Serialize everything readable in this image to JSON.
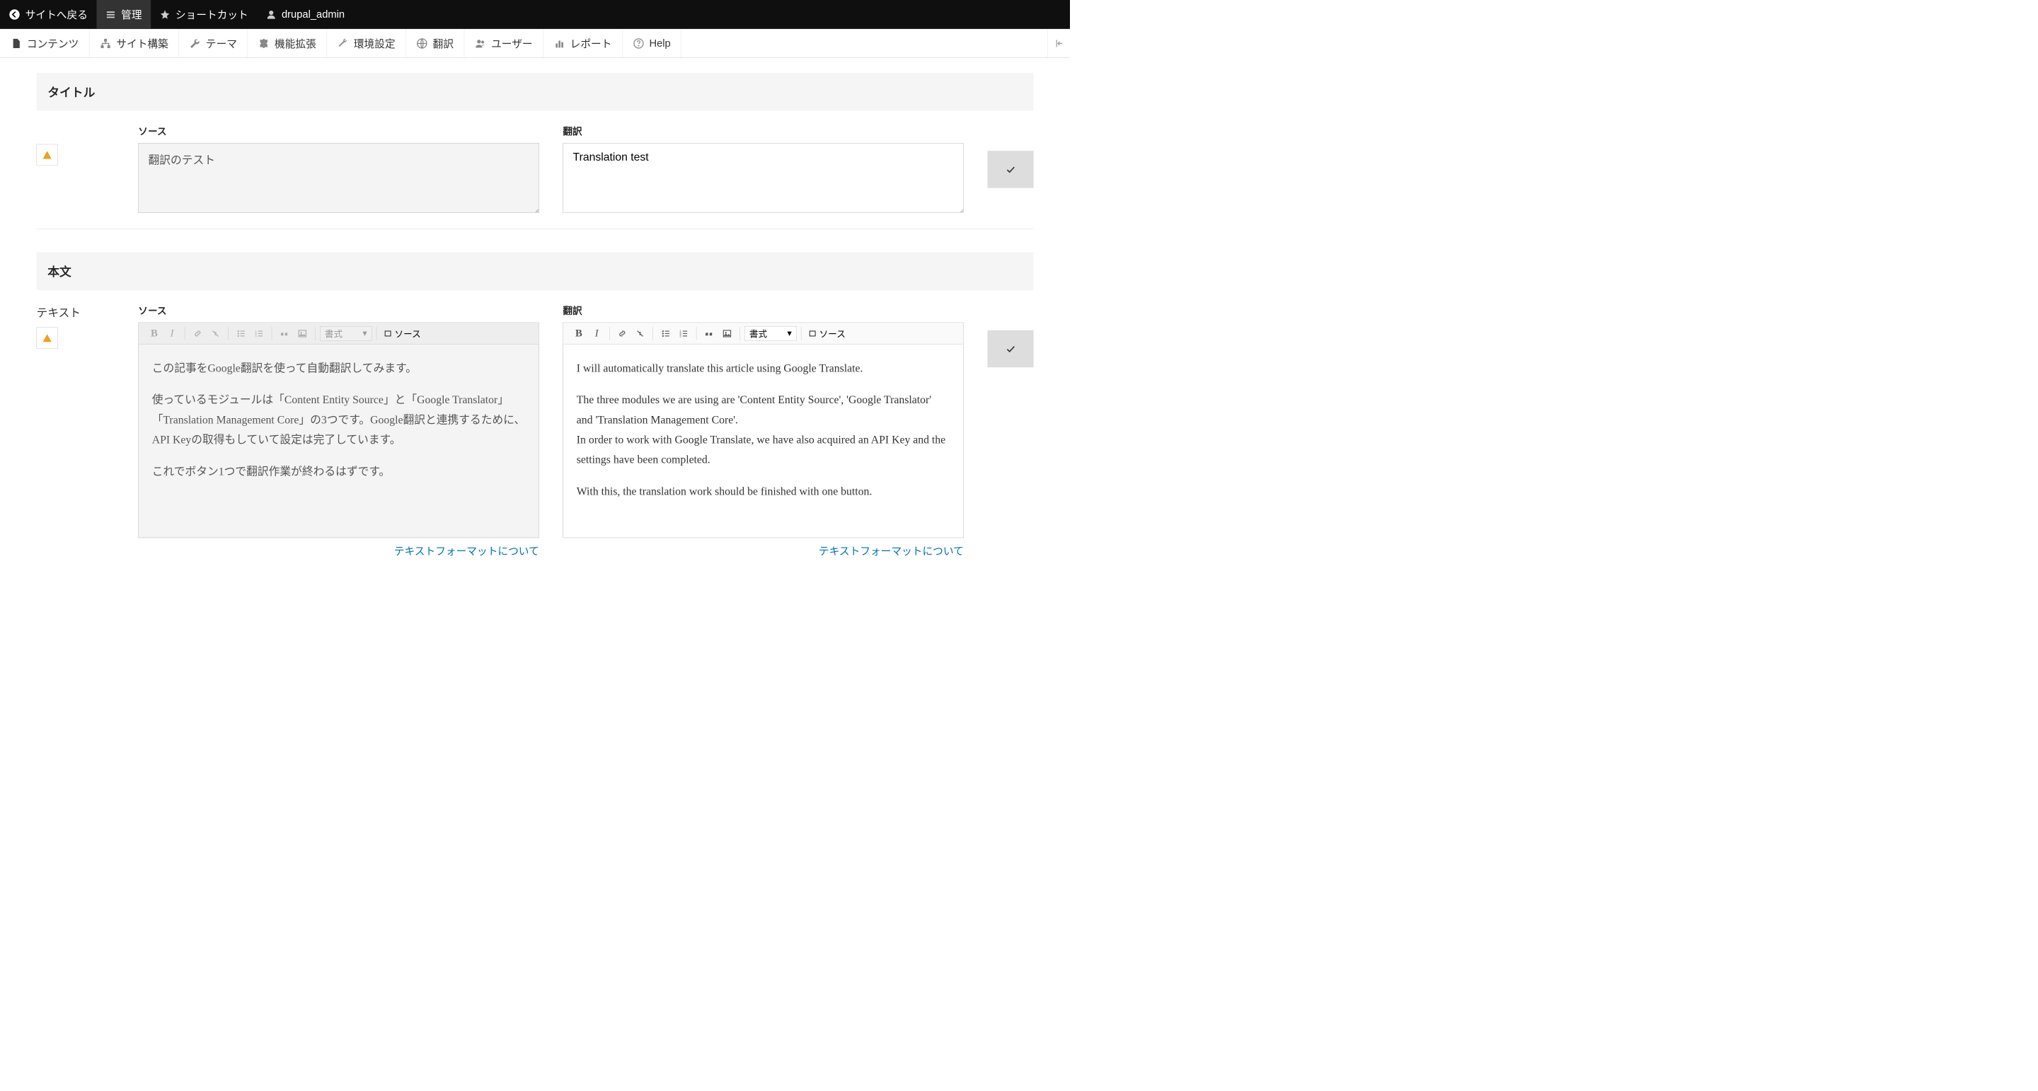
{
  "topbar": {
    "back": "サイトへ戻る",
    "admin": "管理",
    "shortcuts": "ショートカット",
    "user": "drupal_admin"
  },
  "menubar": {
    "content": "コンテンツ",
    "structure": "サイト構築",
    "themes": "テーマ",
    "extensions": "機能拡張",
    "config": "環境設定",
    "translate": "翻訳",
    "users": "ユーザー",
    "reports": "レポート",
    "help": "Help"
  },
  "sections": {
    "title": {
      "header": "タイトル",
      "source_label": "ソース",
      "target_label": "翻訳",
      "source_value": "翻訳のテスト",
      "target_value": "Translation test"
    },
    "body": {
      "header": "本文",
      "side_label": "テキスト",
      "source_label": "ソース",
      "target_label": "翻訳",
      "format_label": "書式",
      "source_btn": "ソース",
      "source_paras": [
        "この記事をGoogle翻訳を使って自動翻訳してみます。",
        "使っているモジュールは「Content Entity Source」と「Google Translator」「Translation Management Core」の3つです。Google翻訳と連携するために、API Keyの取得もしていて設定は完了しています。",
        "これでボタン1つで翻訳作業が終わるはずです。"
      ],
      "target_paras": [
        "I will automatically translate this article using Google Translate.",
        "The three modules we are using are 'Content Entity Source', 'Google Translator' and 'Translation Management Core'.\nIn order to work with Google Translate, we have also acquired an API Key and the settings have been completed.",
        "With this, the translation work should be finished with one button."
      ],
      "format_link": "テキストフォーマットについて"
    }
  }
}
